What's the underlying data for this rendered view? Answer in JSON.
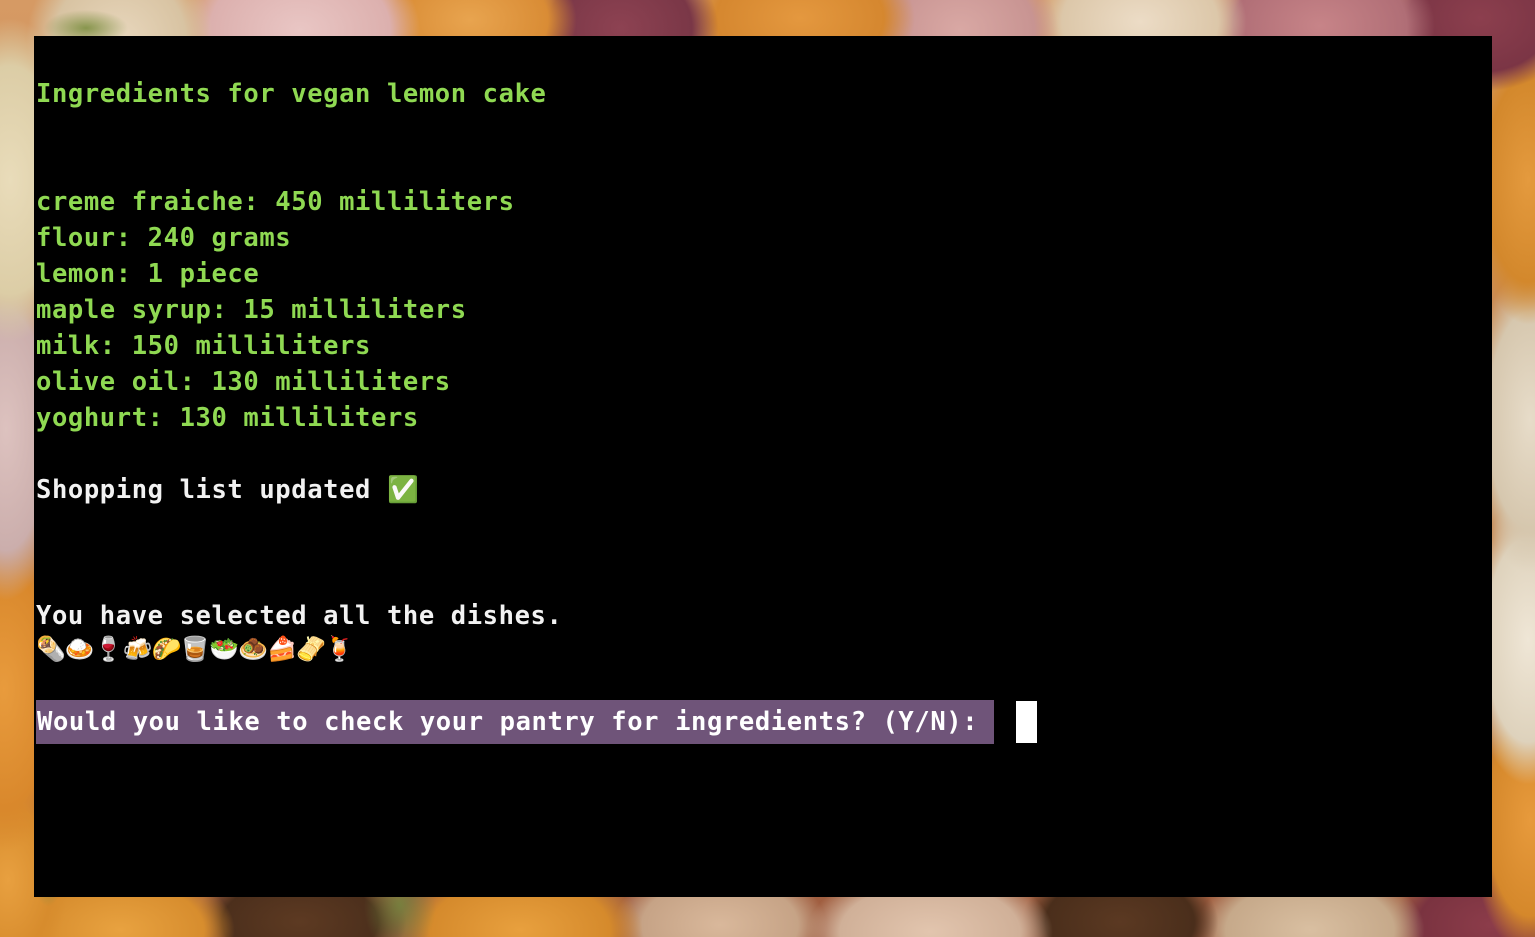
{
  "background": {
    "description": "garlic-and-onion-skins-photo",
    "accent_orange": "#d98c35",
    "accent_pink": "#dcb0ae",
    "accent_cream": "#e9dcba",
    "accent_maroon": "#8c3f4e"
  },
  "terminal": {
    "background_color": "#000000",
    "green_text_color": "#8fd952",
    "white_text_color": "#f2f2f2",
    "highlight_color": "#6f5479",
    "cursor_color": "#ffffff",
    "heading": "Ingredients for vegan lemon cake",
    "ingredients": [
      "creme fraiche: 450 milliliters",
      "flour: 240 grams",
      "lemon: 1 piece",
      "maple syrup: 15 milliliters",
      "milk: 150 milliliters",
      "olive oil: 130 milliliters",
      "yoghurt: 130 milliliters"
    ],
    "status_line": "Shopping list updated ✅",
    "selection_line": "You have selected all the dishes.",
    "dish_emojis": "🌯🍛🍷🍻🌮🥃🥗🧆🍰🫔🍹",
    "dish_emoji_names": [
      "burrito",
      "curry-rice",
      "wine-glass",
      "clinking-beer-mugs",
      "taco",
      "tumbler-glass",
      "green-salad",
      "falafel",
      "shortcake",
      "tamale",
      "tropical-drink"
    ],
    "prompt": "Would you like to check your pantry for ingredients? (Y/N): ",
    "cursor": "█"
  }
}
